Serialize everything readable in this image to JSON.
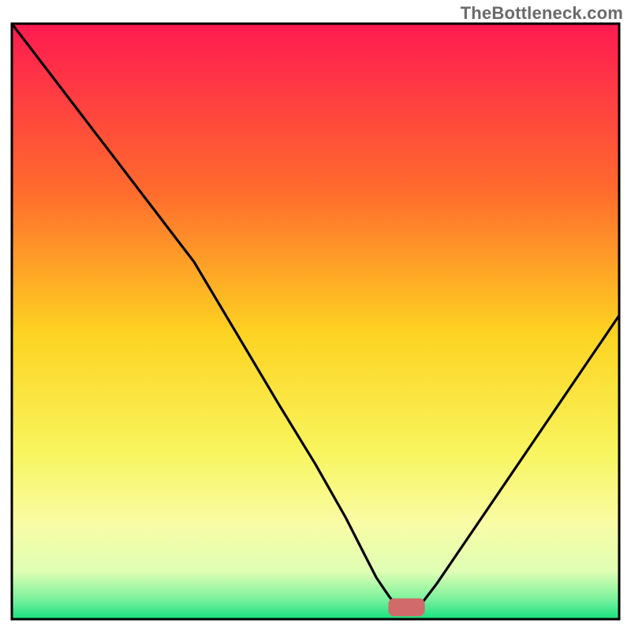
{
  "watermark": {
    "text": "TheBottleneck.com"
  },
  "chart_data": {
    "type": "line",
    "title": "",
    "xlabel": "",
    "ylabel": "",
    "xlim": [
      0,
      100
    ],
    "ylim": [
      0,
      100
    ],
    "grid": false,
    "legend": null,
    "background_gradient": {
      "stops": [
        {
          "offset": 0.0,
          "color": "#ff1a51"
        },
        {
          "offset": 0.28,
          "color": "#ff6b2d"
        },
        {
          "offset": 0.52,
          "color": "#fdd321"
        },
        {
          "offset": 0.72,
          "color": "#f8f55e"
        },
        {
          "offset": 0.84,
          "color": "#f9fca6"
        },
        {
          "offset": 0.92,
          "color": "#dfffb4"
        },
        {
          "offset": 0.965,
          "color": "#7ef29d"
        },
        {
          "offset": 1.0,
          "color": "#17e082"
        }
      ]
    },
    "series": [
      {
        "name": "bottleneck-curve",
        "x": [
          0,
          6,
          12,
          18,
          24,
          30,
          37,
          44,
          50,
          55,
          58,
          60,
          62,
          63.5,
          65,
          67,
          70,
          74,
          78,
          82,
          86,
          90,
          94,
          98,
          100
        ],
        "values": [
          100,
          92,
          84,
          76,
          68,
          60,
          48,
          36,
          26,
          17,
          11,
          7,
          4,
          2,
          2,
          2,
          6,
          12,
          18,
          24,
          30,
          36,
          42,
          48,
          51
        ]
      }
    ],
    "marker": {
      "name": "optimal-range",
      "shape": "rounded-rect",
      "color": "#d16a6a",
      "x_range": [
        62,
        68
      ],
      "y": 2,
      "height": 3
    },
    "frame": {
      "color": "#000000",
      "width": 3
    }
  }
}
